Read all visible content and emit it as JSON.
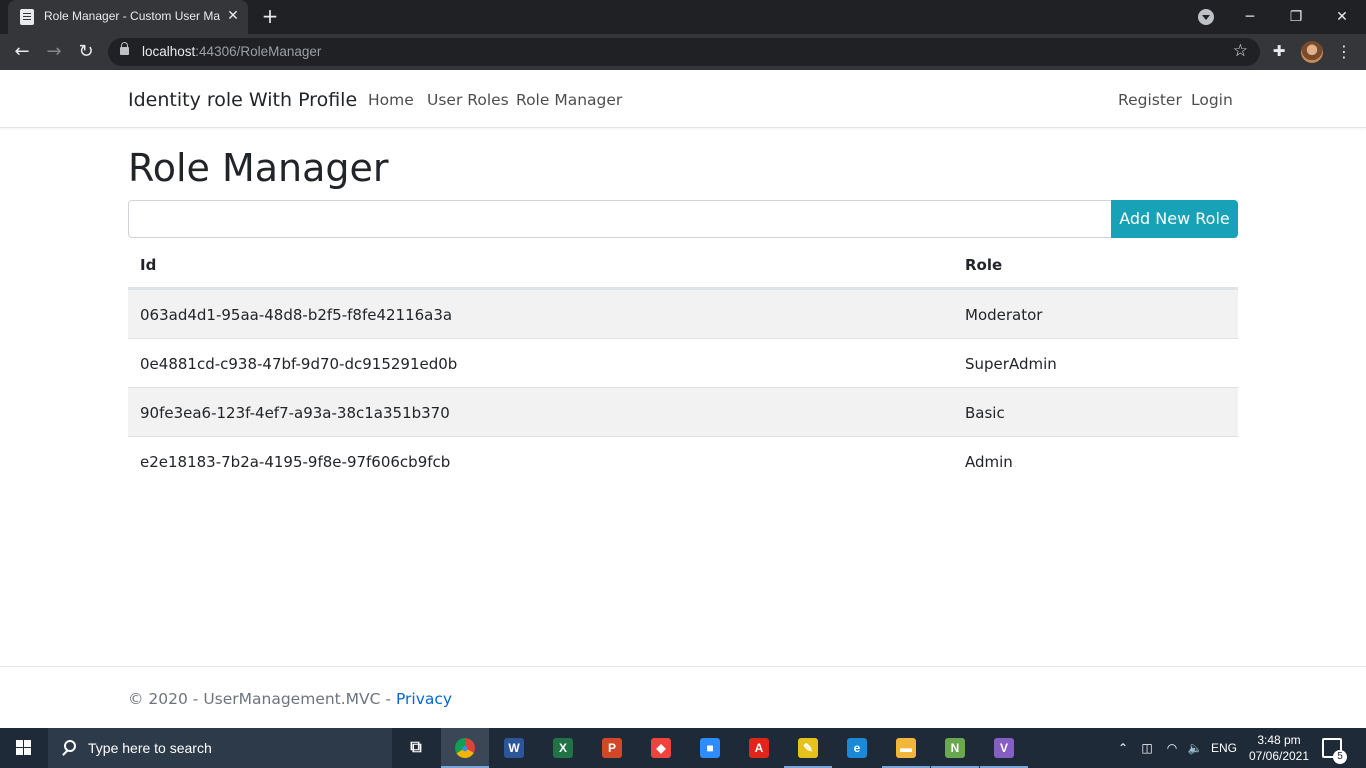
{
  "browser": {
    "tab_title": "Role Manager - Custom User Management",
    "tab_close": "✕",
    "new_tab": "+",
    "url_host": "localhost",
    "url_rest": ":44306/RoleManager"
  },
  "site": {
    "brand": "Identity role With Profile",
    "nav": {
      "home": "Home",
      "user_roles": "User Roles",
      "role_manager": "Role Manager",
      "register": "Register",
      "login": "Login"
    }
  },
  "main": {
    "title": "Role Manager",
    "role_input_value": "",
    "add_button": "Add New Role",
    "table": {
      "headers": {
        "id": "Id",
        "role": "Role"
      },
      "rows": [
        {
          "id": "063ad4d1-95aa-48d8-b2f5-f8fe42116a3a",
          "role": "Moderator"
        },
        {
          "id": "0e4881cd-c938-47bf-9d70-dc915291ed0b",
          "role": "SuperAdmin"
        },
        {
          "id": "90fe3ea6-123f-4ef7-a93a-38c1a351b370",
          "role": "Basic"
        },
        {
          "id": "e2e18183-7b2a-4195-9f8e-97f606cb9fcb",
          "role": "Admin"
        }
      ]
    }
  },
  "footer": {
    "text": "© 2020 - UserManagement.MVC - ",
    "privacy": "Privacy"
  },
  "taskbar": {
    "search_placeholder": "Type here to search",
    "language": "ENG",
    "time": "3:48 pm",
    "date": "07/06/2021",
    "notification_count": "5",
    "apps": [
      {
        "icon": "task-view-icon",
        "glyph": "⧉",
        "color": "#1f2a38"
      },
      {
        "icon": "chrome-icon",
        "glyph": "●",
        "color": "#dd4b3e"
      },
      {
        "icon": "word-icon",
        "glyph": "W",
        "color": "#2b579a"
      },
      {
        "icon": "excel-icon",
        "glyph": "X",
        "color": "#217346"
      },
      {
        "icon": "powerpoint-icon",
        "glyph": "P",
        "color": "#d24726"
      },
      {
        "icon": "anydesk-icon",
        "glyph": "◆",
        "color": "#ef443b"
      },
      {
        "icon": "zoom-icon",
        "glyph": "■",
        "color": "#2d8cff"
      },
      {
        "icon": "acrobat-icon",
        "glyph": "A",
        "color": "#e1251b"
      },
      {
        "icon": "sticky-app-icon",
        "glyph": "✎",
        "color": "#e8c21c"
      },
      {
        "icon": "edge-icon",
        "glyph": "e",
        "color": "#1a8ad6"
      },
      {
        "icon": "file-explorer-icon",
        "glyph": "▬",
        "color": "#f2b63a"
      },
      {
        "icon": "notepad-plus-icon",
        "glyph": "N",
        "color": "#6aa84f"
      },
      {
        "icon": "visual-studio-icon",
        "glyph": "V",
        "color": "#865fc5"
      }
    ]
  },
  "colors": {
    "accent_button": "#17a2b8",
    "link": "#0366d6",
    "taskbar": "#1f2a38"
  }
}
